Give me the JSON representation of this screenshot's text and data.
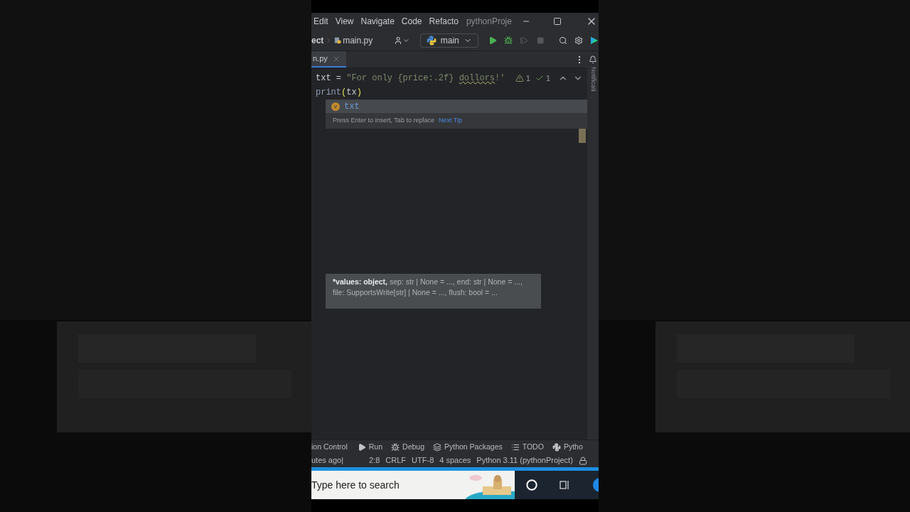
{
  "menu": {
    "items": [
      "Edit",
      "View",
      "Navigate",
      "Code",
      "Refacto"
    ],
    "title": "pythonProje"
  },
  "toolbar": {
    "breadcrumb": [
      "ect",
      "main.py"
    ],
    "run_config": "main"
  },
  "tabs": [
    {
      "label": "n.py",
      "selected": true
    }
  ],
  "editor": {
    "lines": [
      [
        {
          "kind": "ident",
          "text": "txt"
        },
        {
          "kind": "op",
          "text": " = "
        },
        {
          "kind": "string",
          "text": "\"For only {price:.2f} "
        },
        {
          "kind": "typo",
          "text": "dollors"
        },
        {
          "kind": "string",
          "text": "!'"
        }
      ],
      [
        {
          "kind": "builtin",
          "text": "print"
        },
        {
          "kind": "paren",
          "text": "("
        },
        {
          "kind": "ident",
          "text": "tx"
        },
        {
          "kind": "paren",
          "text": ")"
        }
      ]
    ],
    "warnings": "1",
    "weak_warnings": "1",
    "side_label": "Notificati"
  },
  "completion": {
    "items": [
      {
        "badge": "v",
        "text": "txt",
        "selected": true
      }
    ],
    "hint": "Press Enter to insert, Tab to replace",
    "link": "Next Tip"
  },
  "param_hint": {
    "bold": "*values: object,",
    "rest": " sep: str | None = ..., end: str | None = ..., file: SupportsWrite[str] | None = ..., flush: bool = ..."
  },
  "tool_windows": [
    {
      "kind": "none",
      "label": "ion Control"
    },
    {
      "kind": "run",
      "label": "Run"
    },
    {
      "kind": "debug",
      "label": "Debug"
    },
    {
      "kind": "packages",
      "label": "Python Packages"
    },
    {
      "kind": "list",
      "label": "TODO"
    },
    {
      "kind": "python",
      "label": "Pytho"
    }
  ],
  "status": [
    "utes ago|",
    "2:8",
    "CRLF",
    "UTF-8",
    "4 spaces",
    "Python 3.11 (pythonProject)"
  ],
  "taskbar": {
    "placeholder": "Type here to search"
  }
}
